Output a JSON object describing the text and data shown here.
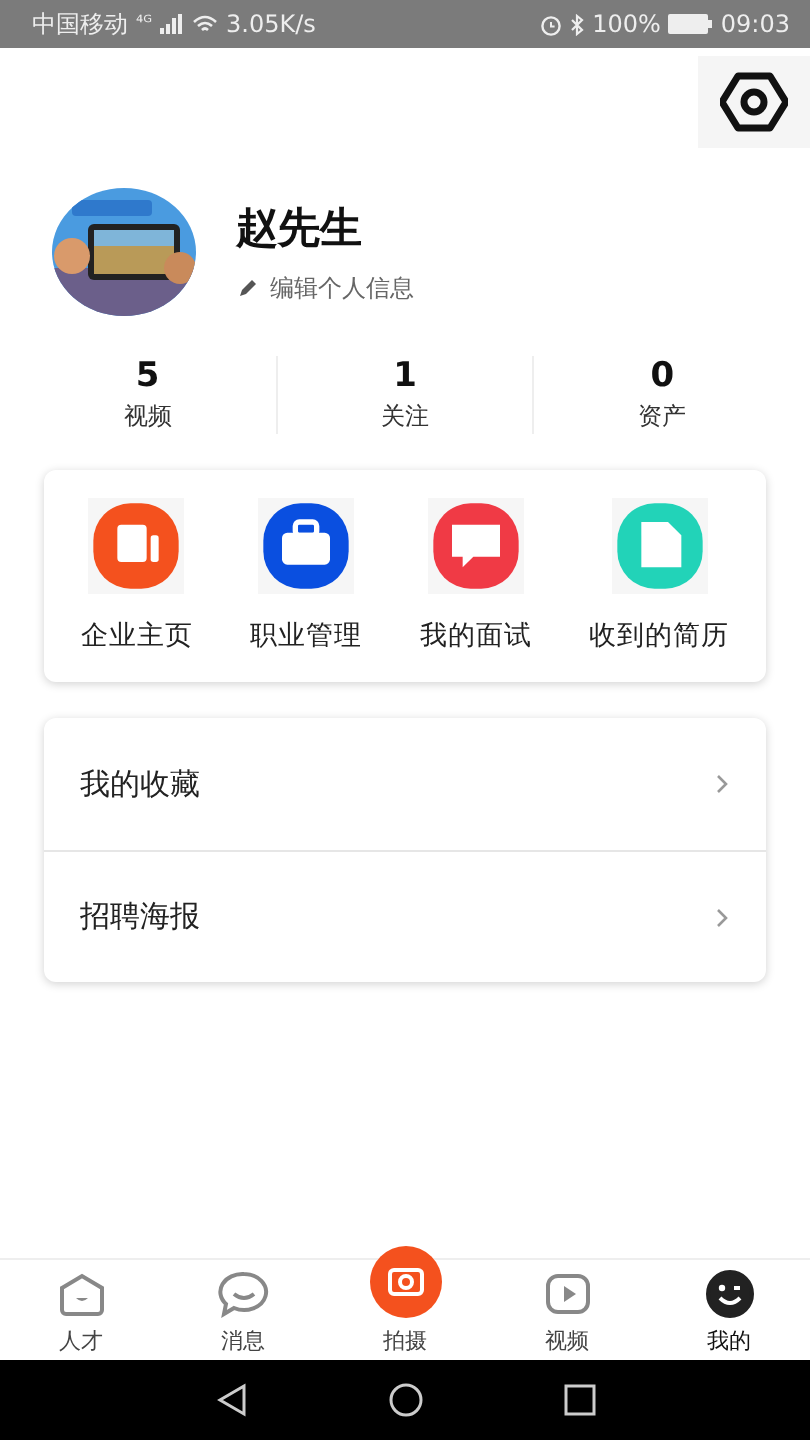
{
  "status_bar": {
    "carrier": "中国移动",
    "network": "⁴ᴳ",
    "speed": "3.05K/s",
    "battery": "100%",
    "time": "09:03"
  },
  "profile": {
    "name": "赵先生",
    "edit_label": "编辑个人信息"
  },
  "stats": [
    {
      "value": "5",
      "label": "视频"
    },
    {
      "value": "1",
      "label": "关注"
    },
    {
      "value": "0",
      "label": "资产"
    }
  ],
  "shortcuts": [
    {
      "label": "企业主页",
      "kind": "doc",
      "color": "#f4511e"
    },
    {
      "label": "职业管理",
      "kind": "briefcase",
      "color": "#0a4fe0"
    },
    {
      "label": "我的面试",
      "kind": "chat",
      "color": "#f03a45"
    },
    {
      "label": "收到的简历",
      "kind": "file",
      "color": "#22d3b8"
    }
  ],
  "menu": [
    {
      "label": "我的收藏"
    },
    {
      "label": "招聘海报"
    }
  ],
  "tabs": [
    {
      "label": "人才",
      "kind": "home",
      "selected": false
    },
    {
      "label": "消息",
      "kind": "chat",
      "selected": false
    },
    {
      "label": "拍摄",
      "kind": "camera",
      "selected": false
    },
    {
      "label": "视频",
      "kind": "play",
      "selected": false
    },
    {
      "label": "我的",
      "kind": "face",
      "selected": true
    }
  ]
}
